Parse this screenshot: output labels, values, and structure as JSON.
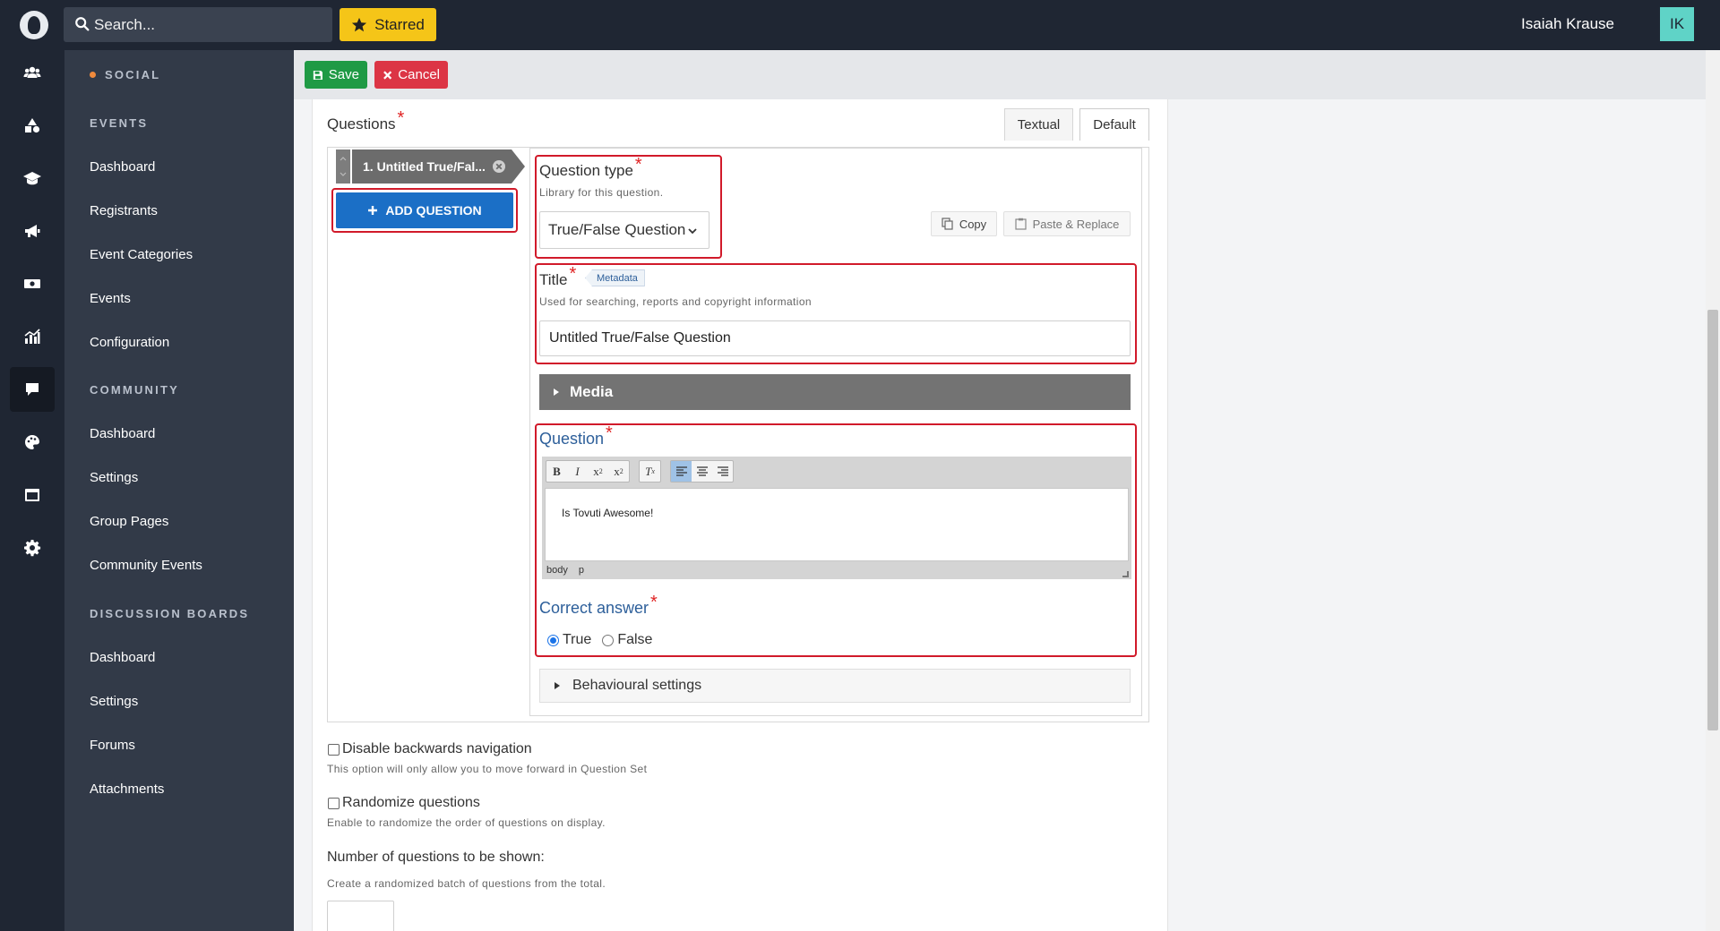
{
  "topbar": {
    "search_placeholder": "Search...",
    "starred_label": "Starred",
    "user_name": "Isaiah Krause",
    "user_initials": "IK"
  },
  "sidebar": {
    "sections": [
      {
        "heading": "SOCIAL",
        "items": []
      },
      {
        "heading": "EVENTS",
        "items": [
          "Dashboard",
          "Registrants",
          "Event Categories",
          "Events",
          "Configuration"
        ]
      },
      {
        "heading": "COMMUNITY",
        "items": [
          "Dashboard",
          "Settings",
          "Group Pages",
          "Community Events"
        ]
      },
      {
        "heading": "DISCUSSION BOARDS",
        "items": [
          "Dashboard",
          "Settings",
          "Forums",
          "Attachments"
        ]
      }
    ]
  },
  "actions": {
    "save_label": "Save",
    "cancel_label": "Cancel"
  },
  "questions": {
    "label": "Questions",
    "tabs": [
      "Textual",
      "Default"
    ],
    "active_tab": "Default",
    "list": [
      {
        "label": "1. Untitled True/Fal..."
      }
    ],
    "add_label": "ADD QUESTION"
  },
  "editor": {
    "question_type": {
      "label": "Question type",
      "hint": "Library for this question.",
      "selected": "True/False Question"
    },
    "copy_label": "Copy",
    "paste_label": "Paste & Replace",
    "title": {
      "label": "Title",
      "badge": "Metadata",
      "hint": "Used for searching, reports and copyright information",
      "value": "Untitled True/False Question"
    },
    "media_label": "Media",
    "question": {
      "label": "Question",
      "content": "Is Tovuti Awesome!",
      "path": [
        "body",
        "p"
      ]
    },
    "correct_answer": {
      "label": "Correct answer",
      "options": [
        "True",
        "False"
      ],
      "selected": "True"
    },
    "behaviour_label": "Behavioural settings"
  },
  "options": {
    "disable_back": {
      "label": "Disable backwards navigation",
      "hint": "This option will only allow you to move forward in Question Set",
      "checked": false
    },
    "randomize": {
      "label": "Randomize questions",
      "hint": "Enable to randomize the order of questions on display.",
      "checked": false
    },
    "num_shown": {
      "label": "Number of questions to be shown:",
      "hint": "Create a randomized batch of questions from the total.",
      "value": ""
    }
  },
  "colors": {
    "rail_bg": "#1f2633",
    "sidebar_bg": "#323a48",
    "save": "#1f9a45",
    "cancel": "#dc3545",
    "starred": "#f5c518",
    "primary": "#1b6fc6",
    "highlight_box": "#d11a2a"
  }
}
